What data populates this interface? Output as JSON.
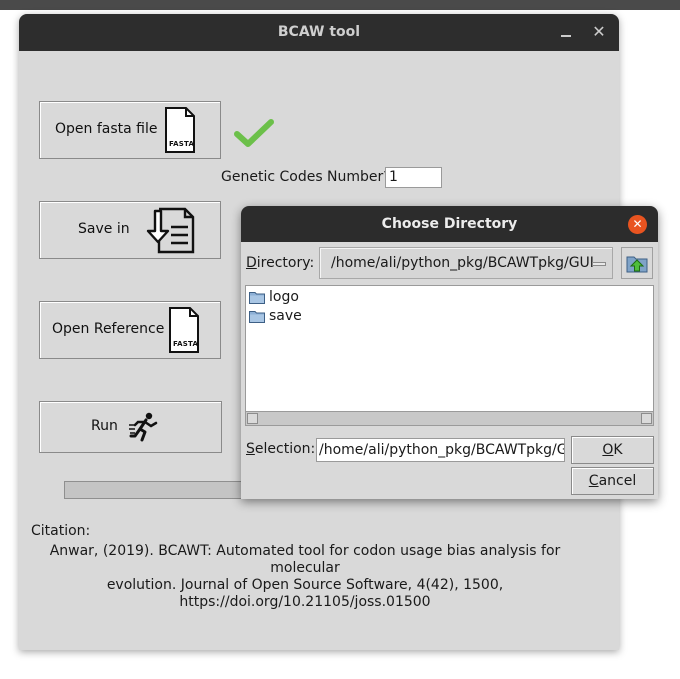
{
  "main_window": {
    "title": "BCAW tool",
    "minimize_icon": "minimize-icon",
    "close_icon": "close-icon"
  },
  "buttons": {
    "open_fasta": {
      "label": "Open fasta file",
      "icon_text": "FASTA"
    },
    "save_in": {
      "label": "Save in"
    },
    "open_reference": {
      "label": "Open Reference",
      "icon_text": "FASTA"
    },
    "run": {
      "label": "Run"
    }
  },
  "genetic_codes": {
    "label": "Genetic Codes Number?",
    "value": "1"
  },
  "status": {
    "check_color": "#6cc04a"
  },
  "citation": {
    "heading": "Citation:",
    "line1": "Anwar, (2019). BCAWT: Automated tool for codon usage bias analysis for molecular",
    "line2": "evolution. Journal of Open Source Software, 4(42), 1500,",
    "line3": "https://doi.org/10.21105/joss.01500"
  },
  "dialog": {
    "title": "Choose Directory",
    "directory_label_prefix": "D",
    "directory_label_rest": "irectory:",
    "directory_value": "/home/ali/python_pkg/BCAWTpkg/GUI",
    "items": [
      {
        "label": "logo"
      },
      {
        "label": "save"
      }
    ],
    "selection_label_prefix": "S",
    "selection_label_rest": "election:",
    "selection_value": "/home/ali/python_pkg/BCAWTpkg/GUI",
    "ok_prefix": "O",
    "ok_rest": "K",
    "cancel_prefix": "C",
    "cancel_rest": "ancel",
    "close_color": "#e95420"
  }
}
